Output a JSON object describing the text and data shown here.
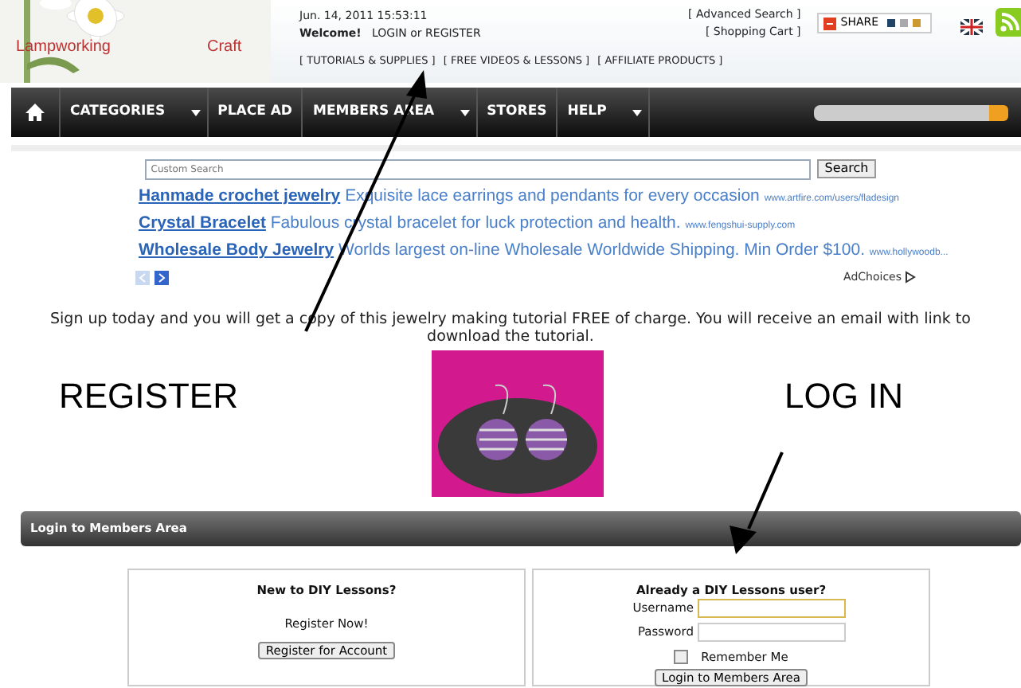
{
  "header": {
    "logo_texts": [
      "Lampworking",
      "Craft"
    ],
    "date": "Jun. 14, 2011 15:53:11",
    "welcome": "Welcome!",
    "login_link": "LOGIN",
    "or": "or",
    "register_link": "REGISTER",
    "section_links": [
      "[ TUTORIALS & SUPPLIES ]",
      "[ FREE VIDEOS & LESSONS ]",
      "[ AFFILIATE PRODUCTS ]"
    ],
    "account_links": [
      "[ Advanced Search ]",
      "[ Shopping Cart ]"
    ],
    "share_label": "SHARE"
  },
  "navbar": {
    "items": [
      {
        "kind": "home"
      },
      {
        "kind": "menu",
        "label": "CATEGORIES",
        "dropdown": true
      },
      {
        "kind": "menu",
        "label": "PLACE AD",
        "dropdown": false
      },
      {
        "kind": "menu",
        "label": "MEMBERS AREA",
        "dropdown": true
      },
      {
        "kind": "menu",
        "label": "STORES",
        "dropdown": false
      },
      {
        "kind": "menu",
        "label": "HELP",
        "dropdown": true
      }
    ]
  },
  "custom_search": {
    "placeholder": "Custom Search",
    "button": "Search"
  },
  "ads": [
    {
      "title": "Hanmade crochet jewelry",
      "text": "Exquisite lace earrings and pendants for every occasion",
      "url": "www.artfire.com/users/fladesign"
    },
    {
      "title": "Crystal Bracelet",
      "text": "Fabulous crystal bracelet for luck protection and health.",
      "url": "www.fengshui-supply.com"
    },
    {
      "title": "Wholesale Body Jewelry",
      "text": "Worlds largest on-line Wholesale Worldwide Shipping. Min Order $100.",
      "url": "www.hollywoodb..."
    }
  ],
  "ad_choices": "AdChoices",
  "signup": {
    "link": "Sign up",
    "text": " today and you will get a copy of this jewelry making tutorial FREE of charge. You will receive an email with link to download the tutorial."
  },
  "annotations": [
    {
      "kind": "label",
      "text": "REGISTER"
    },
    {
      "kind": "label",
      "text": "LOG IN"
    }
  ],
  "login_section": {
    "title": "Login to Members Area",
    "register_box": {
      "heading": "New to DIY Lessons?",
      "text": "Register Now!",
      "button": "Register for Account"
    },
    "login_box": {
      "heading": "Already a DIY Lessons user?",
      "fields": [
        {
          "label": "Username",
          "focused": true
        },
        {
          "label": "Password",
          "focused": false
        }
      ],
      "remember": {
        "label": "Remember Me",
        "checked": false
      },
      "button": "Login to Members Area"
    }
  }
}
